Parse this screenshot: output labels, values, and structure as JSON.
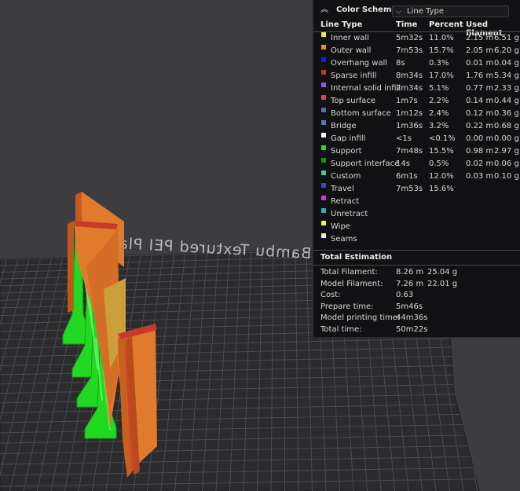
{
  "viewport": {
    "plate_label": "Bambu Textured PEI Plate"
  },
  "panel": {
    "title": "Color Scheme",
    "dropdown_value": "Line Type",
    "headers": {
      "line_type": "Line Type",
      "time": "Time",
      "percent": "Percent",
      "used": "Used filament"
    },
    "rows": [
      {
        "name": "Inner wall",
        "color": "#f2e84a",
        "time": "5m32s",
        "percent": "11.0%",
        "meters": "2.15 m",
        "grams": "6.51 g"
      },
      {
        "name": "Outer wall",
        "color": "#f08a28",
        "time": "7m53s",
        "percent": "15.7%",
        "meters": "2.05 m",
        "grams": "6.20 g"
      },
      {
        "name": "Overhang wall",
        "color": "#1c1cf0",
        "time": "8s",
        "percent": "0.3%",
        "meters": "0.01 m",
        "grams": "0.04 g"
      },
      {
        "name": "Sparse infill",
        "color": "#b83a2c",
        "time": "8m34s",
        "percent": "17.0%",
        "meters": "1.76 m",
        "grams": "5.34 g"
      },
      {
        "name": "Internal solid infill",
        "color": "#a050d8",
        "time": "2m34s",
        "percent": "5.1%",
        "meters": "0.77 m",
        "grams": "2.33 g"
      },
      {
        "name": "Top surface",
        "color": "#e8404a",
        "time": "1m7s",
        "percent": "2.2%",
        "meters": "0.14 m",
        "grams": "0.44 g"
      },
      {
        "name": "Bottom surface",
        "color": "#6060b8",
        "time": "1m12s",
        "percent": "2.4%",
        "meters": "0.12 m",
        "grams": "0.36 g"
      },
      {
        "name": "Bridge",
        "color": "#4a80b8",
        "time": "1m36s",
        "percent": "3.2%",
        "meters": "0.22 m",
        "grams": "0.68 g"
      },
      {
        "name": "Gap infill",
        "color": "#ffffff",
        "time": "<1s",
        "percent": "<0.1%",
        "meters": "0.00 m",
        "grams": "0.00 g"
      },
      {
        "name": "Support",
        "color": "#22e022",
        "time": "7m48s",
        "percent": "15.5%",
        "meters": "0.98 m",
        "grams": "2.97 g"
      },
      {
        "name": "Support interface",
        "color": "#1a8a1a",
        "time": "14s",
        "percent": "0.5%",
        "meters": "0.02 m",
        "grams": "0.06 g"
      },
      {
        "name": "Custom",
        "color": "#4ac88a",
        "time": "6m1s",
        "percent": "12.0%",
        "meters": "0.03 m",
        "grams": "0.10 g"
      },
      {
        "name": "Travel",
        "color": "#3a4ab8",
        "time": "7m53s",
        "percent": "15.6%",
        "meters": "",
        "grams": ""
      },
      {
        "name": "Retract",
        "color": "#d838c8",
        "time": "",
        "percent": "",
        "meters": "",
        "grams": ""
      },
      {
        "name": "Unretract",
        "color": "#38a8c8",
        "time": "",
        "percent": "",
        "meters": "",
        "grams": ""
      },
      {
        "name": "Wipe",
        "color": "#f2f23a",
        "time": "",
        "percent": "",
        "meters": "",
        "grams": ""
      },
      {
        "name": "Seams",
        "color": "#e8e8e8",
        "time": "",
        "percent": "",
        "meters": "",
        "grams": ""
      }
    ],
    "total_title": "Total Estimation",
    "totals": [
      {
        "label": "Total Filament:",
        "v1": "8.26 m",
        "v2": "25.04 g"
      },
      {
        "label": "Model Filament:",
        "v1": "7.26 m",
        "v2": "22.01 g"
      },
      {
        "label": "Cost:",
        "v1": "0.63",
        "v2": ""
      },
      {
        "label": "Prepare time:",
        "v1": "5m46s",
        "v2": ""
      },
      {
        "label": "Model printing time:",
        "v1": "44m36s",
        "v2": ""
      },
      {
        "label": "Total time:",
        "v1": "50m22s",
        "v2": ""
      }
    ]
  }
}
